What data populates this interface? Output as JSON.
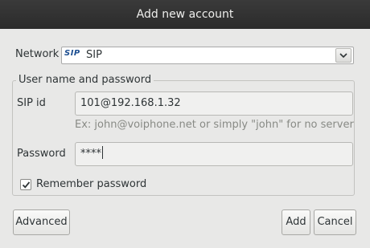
{
  "window": {
    "title": "Add new account"
  },
  "network": {
    "label": "Network",
    "logo_text": "SIP",
    "selected": "SIP",
    "dropdown_icon": "chevron-down-icon"
  },
  "credentials": {
    "group_title": "User name and password",
    "sip_id_label": "SIP id",
    "sip_id_value": "101@192.168.1.32",
    "sip_id_hint": "Ex: john@voiphone.net or simply \"john\" for no server",
    "password_label": "Password",
    "password_value": "****",
    "remember_label": "Remember password",
    "remember_checked": true
  },
  "buttons": {
    "advanced": "Advanced",
    "add": "Add",
    "cancel": "Cancel"
  }
}
